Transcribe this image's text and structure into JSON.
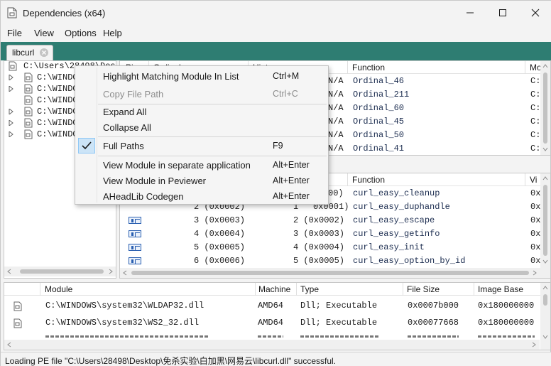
{
  "window": {
    "title": "Dependencies (x64)",
    "minimize_icon": "minimize-icon",
    "maximize_icon": "maximize-icon",
    "close_icon": "close-icon"
  },
  "menu": [
    "File",
    "View",
    "Options",
    "Help"
  ],
  "tabs": [
    {
      "label": "libcurl"
    }
  ],
  "tree": {
    "root": "C:\\Users\\28498\\Des",
    "children": [
      "C:\\WINDO",
      "C:\\WINDO",
      "C:\\WINDO",
      "C:\\WINDO",
      "C:\\WINDO",
      "C:\\WINDO"
    ]
  },
  "imports": {
    "columns": [
      "Pi",
      "Ordinal",
      "Hint",
      "Function",
      "Mo"
    ],
    "rows": [
      {
        "hint": "N/A",
        "function": "Ordinal_46",
        "module": "C:"
      },
      {
        "hint": "N/A",
        "function": "Ordinal_211",
        "module": "C:"
      },
      {
        "hint": "N/A",
        "function": "Ordinal_60",
        "module": "C:"
      },
      {
        "hint": "N/A",
        "function": "Ordinal_45",
        "module": "C:"
      },
      {
        "hint": "N/A",
        "function": "Ordinal_50",
        "module": "C:"
      },
      {
        "hint": "N/A",
        "function": "Ordinal_41",
        "module": "C:"
      }
    ]
  },
  "exports": {
    "columns": [
      "Function",
      "Vi"
    ],
    "rows": [
      {
        "ordinal": "",
        "hint": "00)",
        "function": "curl_easy_cleanup",
        "va": "0x"
      },
      {
        "ordinal": "",
        "hint": "0x0001)",
        "function": "curl_easy_duphandle",
        "va": "0x"
      },
      {
        "ordinal": "3 (0x0003)",
        "hint": "2 (0x0002)",
        "function": "curl_easy_escape",
        "va": "0x"
      },
      {
        "ordinal": "4 (0x0004)",
        "hint": "3 (0x0003)",
        "function": "curl_easy_getinfo",
        "va": "0x"
      },
      {
        "ordinal": "5 (0x0005)",
        "hint": "4 (0x0004)",
        "function": "curl_easy_init",
        "va": "0x"
      },
      {
        "ordinal": "6 (0x0006)",
        "hint": "5 (0x0005)",
        "function": "curl_easy_option_by_id",
        "va": "0x"
      }
    ],
    "partial_ordinal": "2 (0x0002)",
    "partial_hint_num": "1"
  },
  "modules": {
    "columns": [
      "Module",
      "Machine",
      "Type",
      "File Size",
      "Image Base"
    ],
    "rows": [
      {
        "module": "C:\\WINDOWS\\system32\\WLDAP32.dll",
        "machine": "AMD64",
        "type": "Dll; Executable",
        "size": "0x0007b000",
        "base": "0x180000000"
      },
      {
        "module": "C:\\WINDOWS\\system32\\WS2_32.dll",
        "machine": "AMD64",
        "type": "Dll; Executable",
        "size": "0x00077668",
        "base": "0x180000000"
      }
    ]
  },
  "context_menu": [
    {
      "label": "Highlight Matching Module In List",
      "shortcut": "Ctrl+M",
      "enabled": true,
      "checked": false
    },
    {
      "label": "Copy File Path",
      "shortcut": "Ctrl+C",
      "enabled": false,
      "checked": false
    },
    {
      "label": "Expand All",
      "shortcut": "",
      "enabled": true,
      "checked": false
    },
    {
      "label": "Collapse All",
      "shortcut": "",
      "enabled": true,
      "checked": false
    },
    {
      "label": "Full Paths",
      "shortcut": "F9",
      "enabled": true,
      "checked": true
    },
    {
      "label": "View Module in separate application",
      "shortcut": "Alt+Enter",
      "enabled": true,
      "checked": false
    },
    {
      "label": "View Module in Peviewer",
      "shortcut": "Alt+Enter",
      "enabled": true,
      "checked": false
    },
    {
      "label": "AHeadLib Codegen",
      "shortcut": "Alt+Enter",
      "enabled": true,
      "checked": false
    }
  ],
  "status": "Loading PE file \"C:\\Users\\28498\\Desktop\\免杀实验\\白加黑\\网易云\\libcurl.dll\" successful.",
  "colors": {
    "tab_strip": "#2e7d72",
    "check_highlight": "#cce4f7"
  }
}
